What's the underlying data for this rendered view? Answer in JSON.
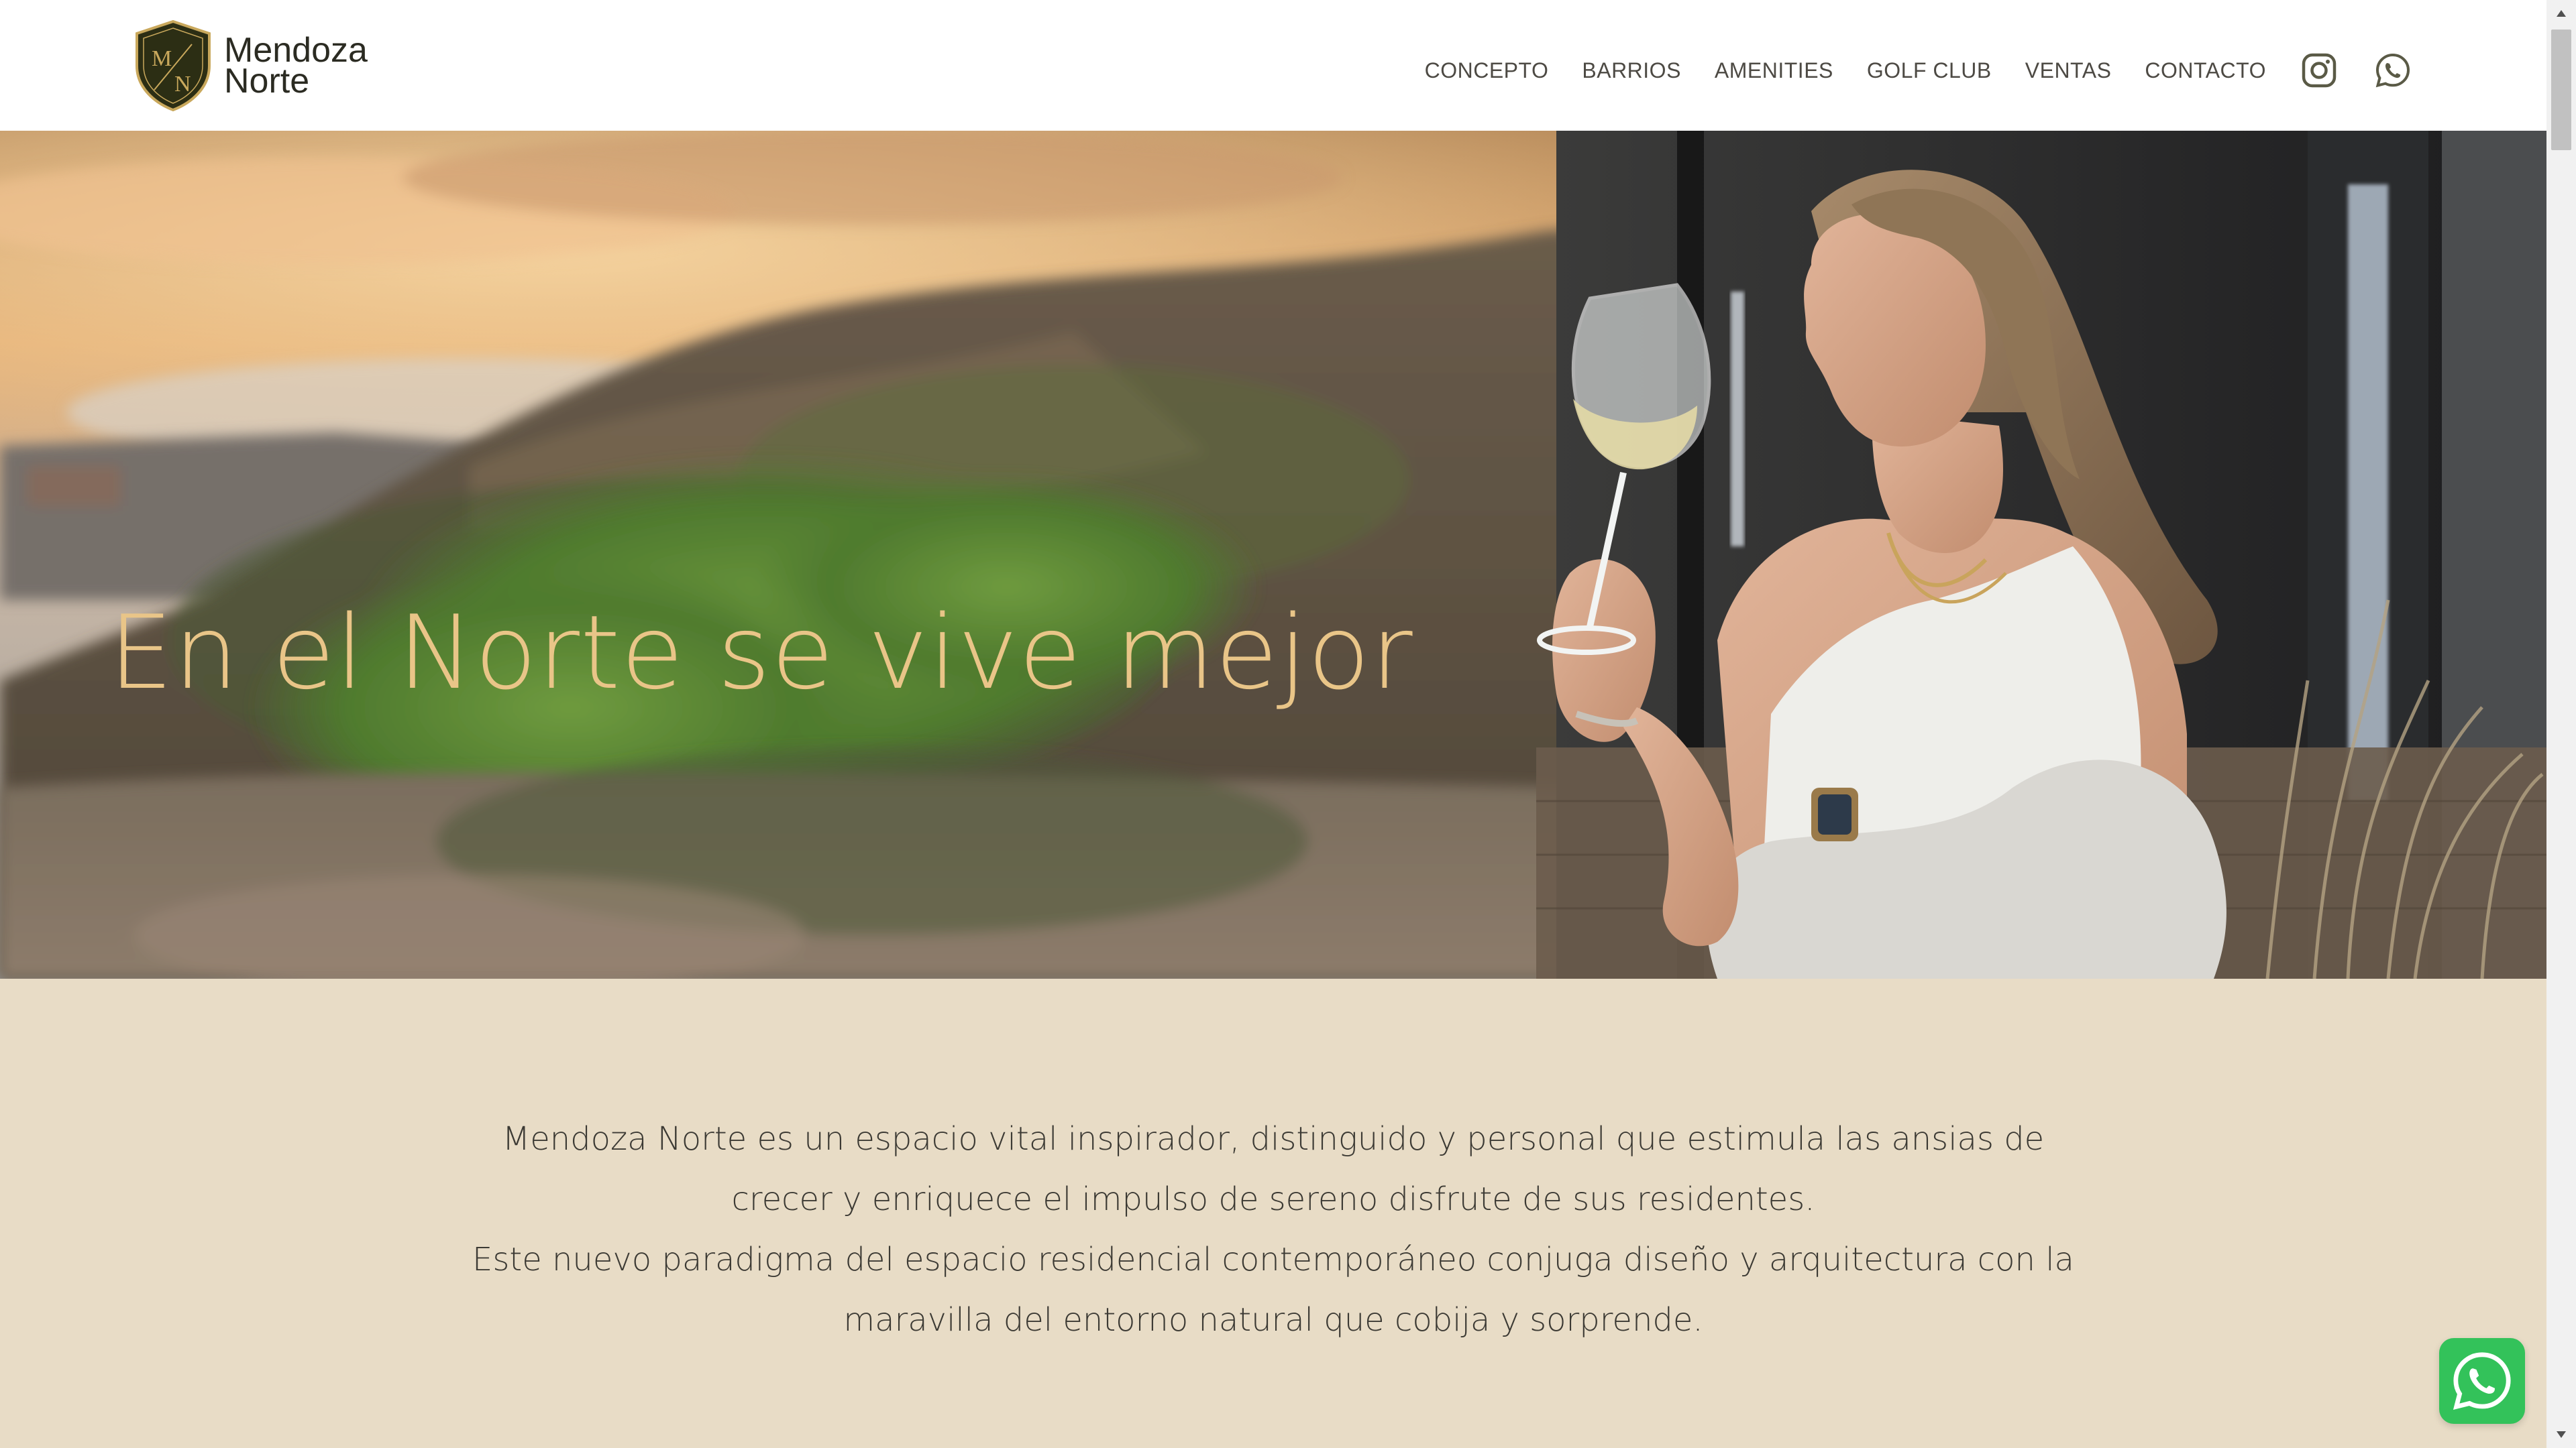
{
  "brand": {
    "name_line1": "Mendoza",
    "name_line2": "Norte",
    "monogram_top": "M",
    "monogram_bottom": "N",
    "shield_color": "#2c2e14",
    "gold_color": "#c9a85c"
  },
  "nav": {
    "items": [
      {
        "label": "CONCEPTO"
      },
      {
        "label": "BARRIOS"
      },
      {
        "label": "AMENITIES"
      },
      {
        "label": "GOLF CLUB"
      },
      {
        "label": "VENTAS"
      },
      {
        "label": "CONTACTO"
      }
    ],
    "social_icons": [
      "instagram-icon",
      "whatsapp-icon"
    ],
    "icon_color": "#5a5a46"
  },
  "hero": {
    "title": "En el Norte se vive mejor",
    "title_color": "#e9c588"
  },
  "intro": {
    "lines": [
      "Mendoza Norte es un espacio vital inspirador, distinguido y personal que estimula las ansias de",
      "crecer y enriquece el impulso de sereno disfrute de sus residentes.",
      "Este nuevo paradigma del espacio residencial contemporáneo conjuga diseño y arquitectura con la",
      "maravilla del entorno natural que cobija y sorprende."
    ],
    "background": "#e8dcc6"
  },
  "floating_button": {
    "icon": "whatsapp-icon",
    "color": "#33c25a"
  }
}
